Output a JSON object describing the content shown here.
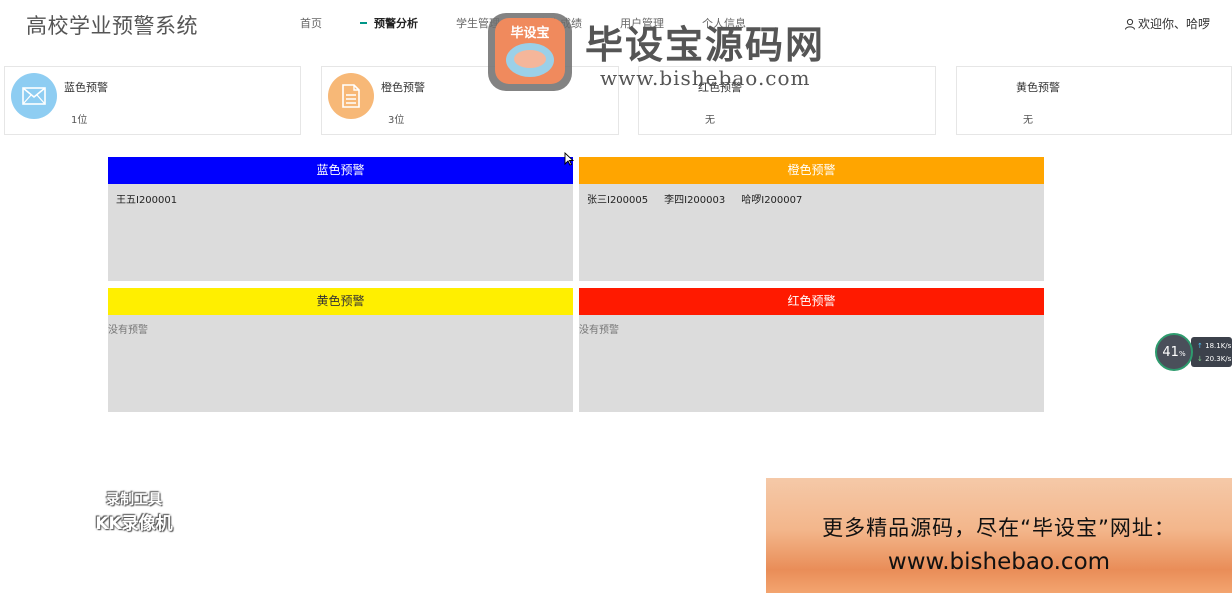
{
  "header": {
    "title": "高校学业预警系统",
    "nav": [
      {
        "label": "首页",
        "active": false
      },
      {
        "label": "预警分析",
        "active": true
      },
      {
        "label": "学生管理",
        "active": false
      },
      {
        "label": "学生成绩",
        "active": false
      },
      {
        "label": "用户管理",
        "active": false
      },
      {
        "label": "个人信息",
        "active": false
      }
    ],
    "user_label": "欢迎你、哈啰"
  },
  "cards": [
    {
      "title": "蓝色预警",
      "value": "1位",
      "icon": "mail-icon",
      "color": "#8ecdf2"
    },
    {
      "title": "橙色预警",
      "value": "3位",
      "icon": "document-icon",
      "color": "#f7b877"
    },
    {
      "title": "红色预警",
      "value": "无",
      "icon": "",
      "color": ""
    },
    {
      "title": "黄色预警",
      "value": "无",
      "icon": "",
      "color": ""
    }
  ],
  "panels": {
    "blue": {
      "title": "蓝色预警",
      "color": "#0000ff",
      "text_color": "#ffffff",
      "students": [
        "王五I200001"
      ],
      "empty_text": ""
    },
    "orange": {
      "title": "橙色预警",
      "color": "#ffa500",
      "text_color": "#ffffff",
      "students": [
        "张三I200005",
        "李四I200003",
        "哈啰I200007"
      ],
      "empty_text": ""
    },
    "yellow": {
      "title": "黄色预警",
      "color": "#ffef00",
      "text_color": "#333333",
      "students": [],
      "empty_text": "没有预警"
    },
    "red": {
      "title": "红色预警",
      "color": "#ff1a00",
      "text_color": "#ffffff",
      "students": [],
      "empty_text": "没有预警"
    }
  },
  "overlay": {
    "logo_text": "毕设宝",
    "brand_cn": "毕设宝源码网",
    "brand_url": "www.bishebao.com",
    "speed_percent": "41",
    "speed_pct_sign": "%",
    "speed_up": "18.1",
    "speed_down": "20.3",
    "speed_unit": "K/s",
    "recorder_line1": "录制工具",
    "recorder_line2": "KK录像机",
    "promo_line1": "更多精品源码，尽在“毕设宝”网址：",
    "promo_line2": "www.bishebao.com"
  }
}
